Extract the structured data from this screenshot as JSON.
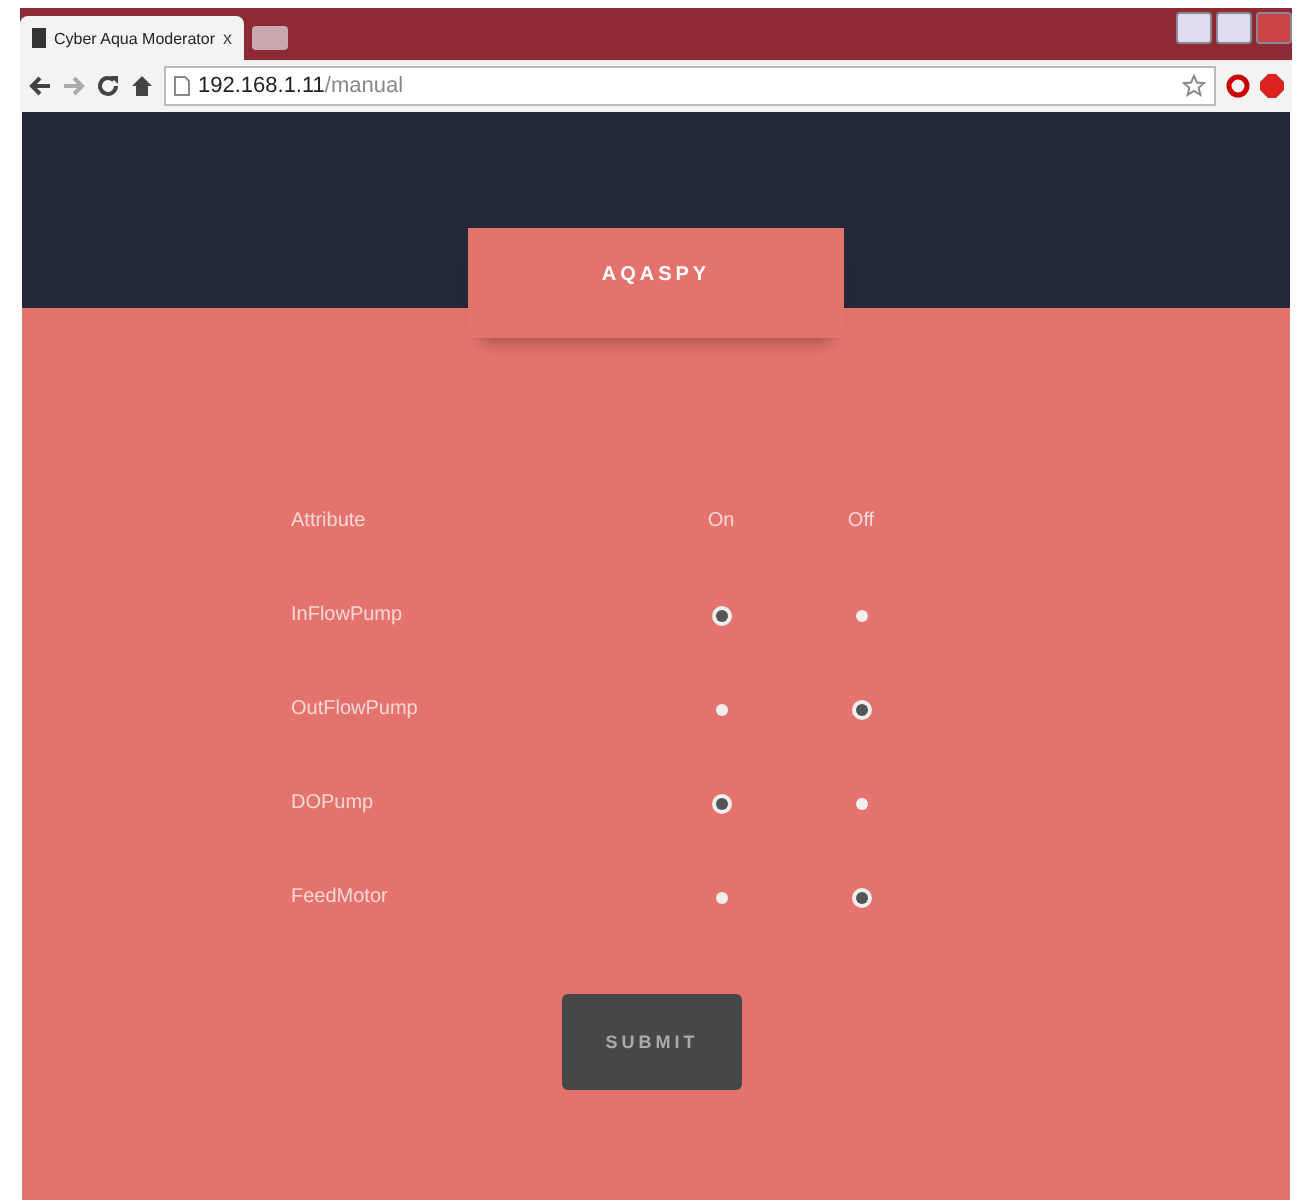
{
  "browser": {
    "tab_title": "Cyber Aqua Moderator",
    "tab_close": "x",
    "address_host": "192.168.1.11",
    "address_path": "/manual"
  },
  "header": {
    "brand": "AQASPY"
  },
  "table": {
    "columns": [
      "Attribute",
      "On",
      "Off"
    ],
    "rows": [
      {
        "name": "InFlowPump",
        "on_selected": true,
        "off_selected": false
      },
      {
        "name": "OutFlowPump",
        "on_selected": false,
        "off_selected": true
      },
      {
        "name": "DOPump",
        "on_selected": true,
        "off_selected": false
      },
      {
        "name": "FeedMotor",
        "on_selected": false,
        "off_selected": true
      }
    ]
  },
  "submit": "SUBMIT"
}
